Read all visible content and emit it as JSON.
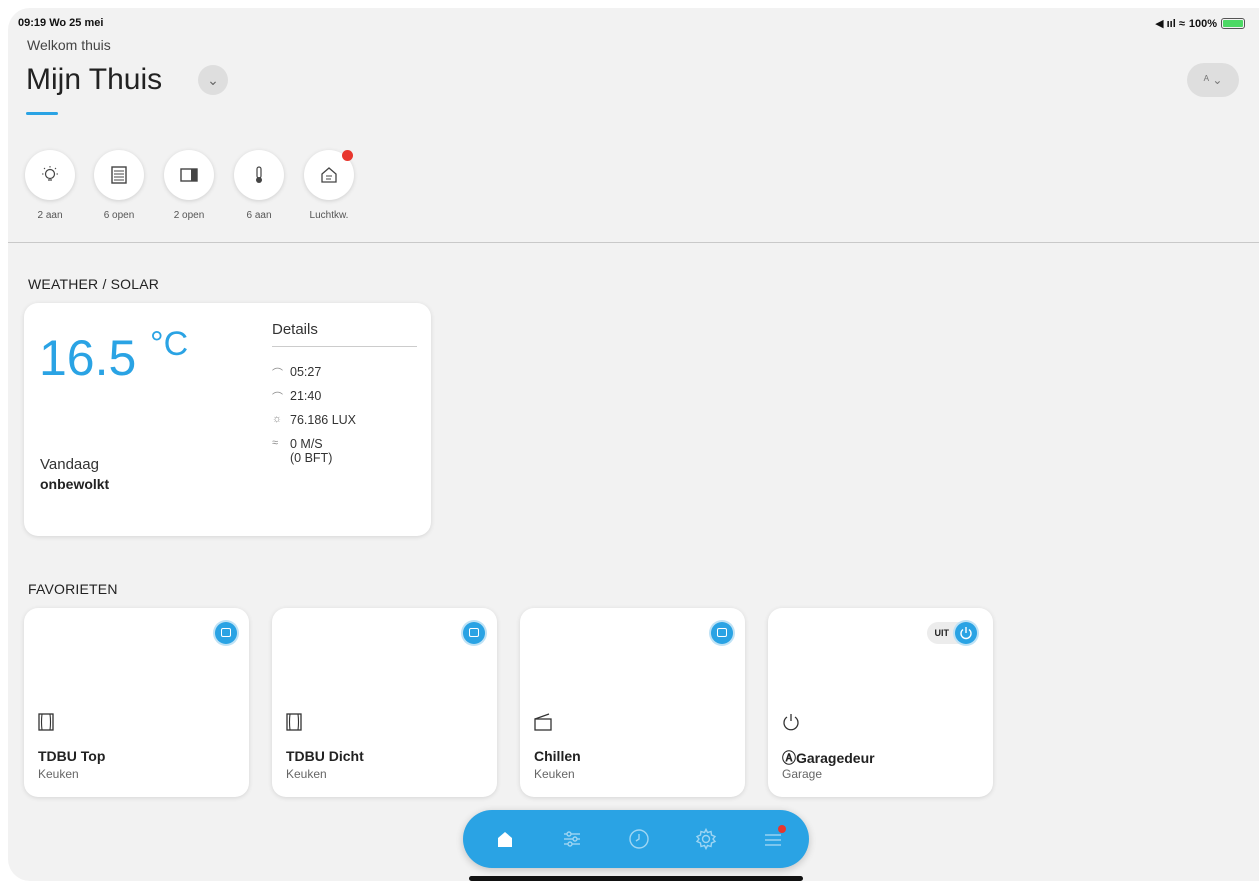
{
  "status": {
    "time_date": "09:19  Wo 25 mei",
    "signal": "◀ ııl ≈",
    "battery": "100%"
  },
  "header": {
    "welcome": "Welkom thuis",
    "home_name": "Mijn Thuis",
    "chevron": "⌄",
    "user": "ᴬ ⌄"
  },
  "quick_actions": [
    {
      "label": "2 aan",
      "icon": "lightbulb-icon"
    },
    {
      "label": "6 open",
      "icon": "blinds-icon"
    },
    {
      "label": "2 open",
      "icon": "window-icon"
    },
    {
      "label": "6 aan",
      "icon": "thermometer-icon"
    },
    {
      "label": "Luchtkw.",
      "icon": "air-quality-icon"
    }
  ],
  "weather": {
    "section_title": "WEATHER / SOLAR",
    "temperature": "16.5",
    "unit": "°C",
    "today_label": "Vandaag",
    "condition": "onbewolkt",
    "details_title": "Details",
    "sunrise": "05:27",
    "sunset": "21:40",
    "lux": "76.186 LUX",
    "wind": "0 M/S",
    "wind_bft": "(0 BFT)"
  },
  "favorites": {
    "section_title": "FAVORIETEN",
    "items": [
      {
        "title": "TDBU Top",
        "room": "Keuken"
      },
      {
        "title": "TDBU Dicht",
        "room": "Keuken"
      },
      {
        "title": "Chillen",
        "room": "Keuken"
      },
      {
        "title": "ⒶGaragedeur",
        "room": "Garage",
        "state": "UIT"
      }
    ]
  },
  "colors": {
    "accent": "#2aa3e4",
    "alert": "#e8362d",
    "background": "#f2f2f2"
  }
}
